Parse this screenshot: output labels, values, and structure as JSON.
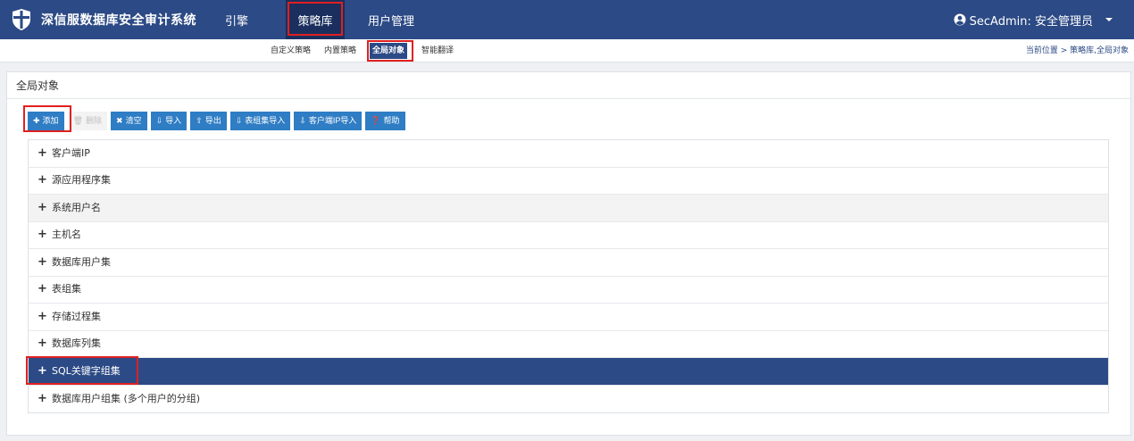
{
  "app": {
    "title": "深信服数据库安全审计系统"
  },
  "nav": {
    "items": [
      {
        "label": "引擎"
      },
      {
        "label": "策略库"
      },
      {
        "label": "用户管理"
      }
    ]
  },
  "user": {
    "label": "SecAdmin: 安全管理员"
  },
  "subnav": {
    "items": [
      {
        "label": "自定义策略"
      },
      {
        "label": "内置策略"
      },
      {
        "label": "全局对象"
      },
      {
        "label": "智能翻译"
      }
    ]
  },
  "breadcrumb": "当前位置 > 策略库,全局对象",
  "panel": {
    "title": "全局对象"
  },
  "toolbar": {
    "add": "添加",
    "delete": "删除",
    "clear": "清空",
    "import": "导入",
    "export": "导出",
    "table_group_import": "表组集导入",
    "client_ip_import": "客户端IP导入",
    "help": "帮助"
  },
  "list": [
    {
      "label": "客户端IP"
    },
    {
      "label": "源应用程序集"
    },
    {
      "label": "系统用户名"
    },
    {
      "label": "主机名"
    },
    {
      "label": "数据库用户集"
    },
    {
      "label": "表组集"
    },
    {
      "label": "存储过程集"
    },
    {
      "label": "数据库列集"
    },
    {
      "label": "SQL关键字组集"
    },
    {
      "label": "数据库用户组集 (多个用户的分组)"
    }
  ],
  "colors": {
    "primary": "#2c4a85",
    "button": "#2f7dc4",
    "highlight": "#e02020"
  }
}
